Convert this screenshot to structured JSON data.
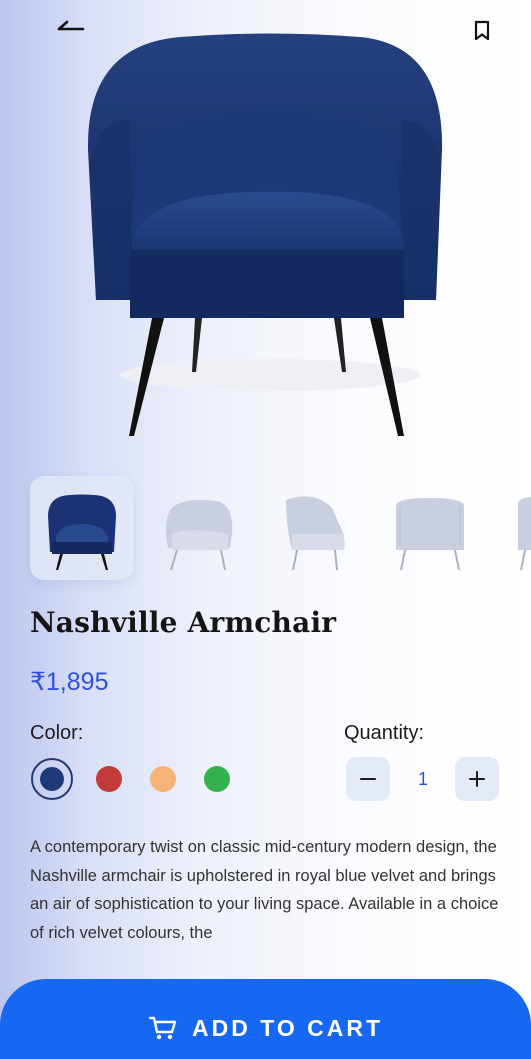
{
  "header": {
    "back_icon": "arrow-left-icon",
    "bookmark_icon": "bookmark-icon"
  },
  "gallery": {
    "main_image": "blue-velvet-armchair",
    "thumbnails": [
      {
        "name": "armchair-blue-front",
        "color": "#1d3275"
      },
      {
        "name": "armchair-angle-left",
        "color": "#c9cfe0"
      },
      {
        "name": "armchair-side",
        "color": "#c9cfe0"
      },
      {
        "name": "armchair-back",
        "color": "#c9cfe0"
      },
      {
        "name": "armchair-partial",
        "color": "#c9cfe0"
      }
    ]
  },
  "product": {
    "name": "Nashville Armchair",
    "price": "₹1,895",
    "color_label": "Color:",
    "colors": [
      {
        "name": "royal-blue",
        "hex": "#1f3a78",
        "selected": true
      },
      {
        "name": "red",
        "hex": "#c23a3a",
        "selected": false
      },
      {
        "name": "peach",
        "hex": "#f6b277",
        "selected": false
      },
      {
        "name": "green",
        "hex": "#34b14f",
        "selected": false
      }
    ],
    "quantity_label": "Quantity:",
    "quantity": "1",
    "description": "A contemporary twist on classic mid-century modern design, the Nashville armchair is upholstered in royal blue velvet and brings an air of sophistication to your living space. Available in a choice of rich velvet colours, the"
  },
  "cta": {
    "label": "ADD TO CART",
    "icon": "cart-icon",
    "color": "#1667f2"
  },
  "accent": "#2f52d8"
}
